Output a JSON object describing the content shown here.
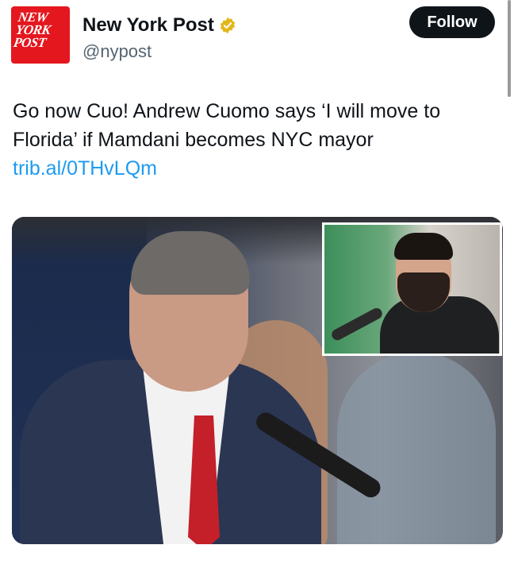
{
  "account": {
    "logo_lines": [
      "NEW",
      "YORK",
      "POST"
    ],
    "display_name": "New York Post",
    "handle": "@nypost",
    "verified_color": "#e2b719"
  },
  "follow_button": {
    "label": "Follow"
  },
  "tweet": {
    "text": "Go now Cuo! Andrew Cuomo says ‘I will move to Florida’ if Mamdani becomes NYC mayor ",
    "link": "trib.al/0THvLQm"
  },
  "colors": {
    "brand_red": "#e4161e",
    "link": "#1d9bf0",
    "button": "#0f1419"
  }
}
